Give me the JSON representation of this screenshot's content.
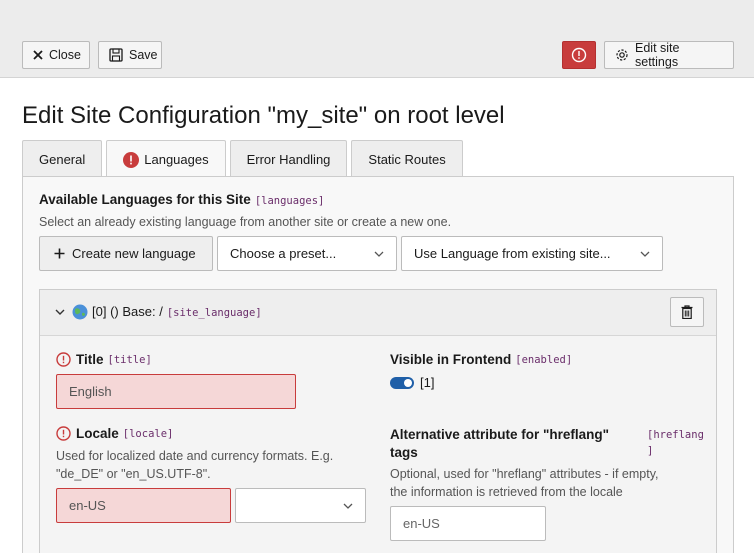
{
  "toolbar": {
    "close_label": "Close",
    "save_label": "Save",
    "edit_settings_label": "Edit site settings"
  },
  "page": {
    "title": "Edit Site Configuration \"my_site\" on root level"
  },
  "tabs": [
    {
      "label": "General",
      "active": false,
      "error": false
    },
    {
      "label": "Languages",
      "active": true,
      "error": true
    },
    {
      "label": "Error Handling",
      "active": false,
      "error": false
    },
    {
      "label": "Static Routes",
      "active": false,
      "error": false
    }
  ],
  "languages_section": {
    "heading": "Available Languages for this Site",
    "code": "[languages]",
    "description": "Select an already existing language from another site or create a new one.",
    "create_button": "Create new language",
    "preset_select": "Choose a preset...",
    "existing_select": "Use Language from existing site..."
  },
  "language_card": {
    "header_label": "[0] () Base: /",
    "header_code": "[site_language]",
    "title_field": {
      "label": "Title",
      "code": "[title]",
      "value": "English"
    },
    "visible_field": {
      "label": "Visible in Frontend",
      "code": "[enabled]",
      "value": "[1]",
      "on": true
    },
    "locale_field": {
      "label": "Locale",
      "code": "[locale]",
      "description_1": "Used for localized date and currency formats. E.g.",
      "description_2": "\"de_DE\" or \"en_US.UTF-8\".",
      "value": "en-US",
      "select_value": ""
    },
    "hreflang_field": {
      "label_1": "Alternative attribute for \"hreflang\"",
      "label_2": "tags",
      "code_1": "[hreflang",
      "code_2": "]",
      "description_1": "Optional, used for \"hreflang\" attributes - if empty,",
      "description_2": "the information is retrieved from the locale",
      "placeholder": "en-US"
    }
  },
  "colors": {
    "error": "#c83c3c",
    "code": "#6a2d6a",
    "toggle": "#1f5fa8"
  }
}
